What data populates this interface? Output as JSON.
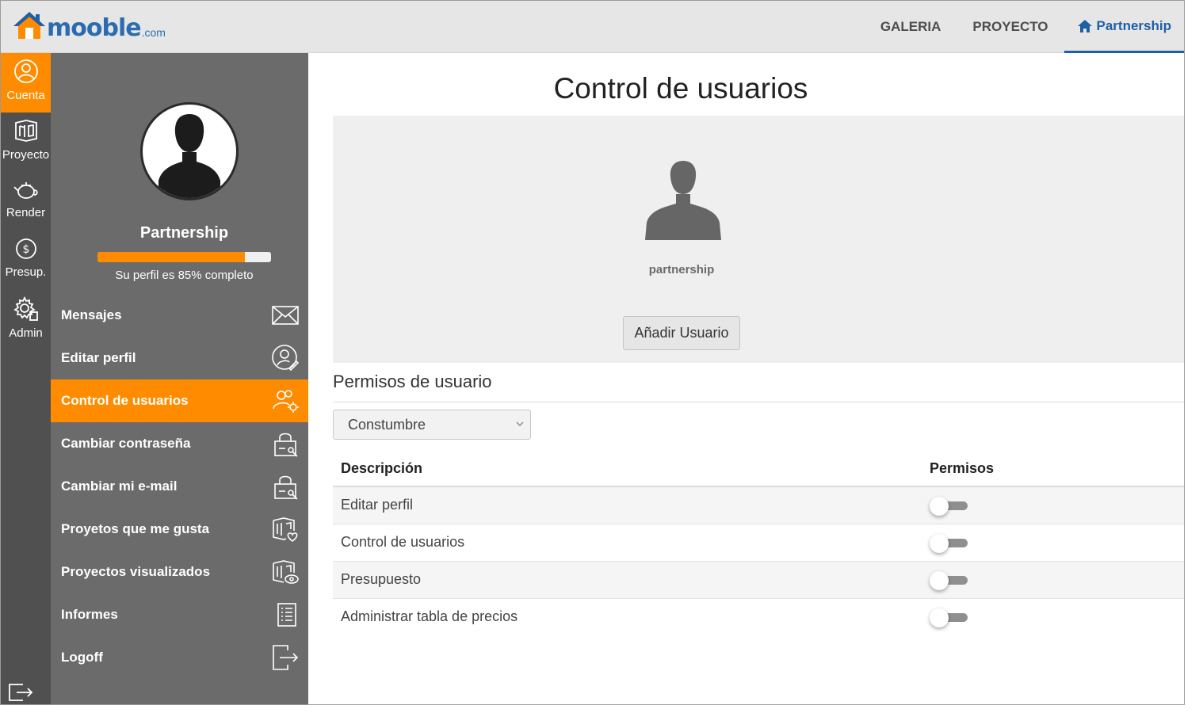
{
  "brand": {
    "name": "mooble",
    "tld": ".com",
    "logo_color": "#2b6cb0"
  },
  "topnav": {
    "items": [
      {
        "label": "GALERIA"
      },
      {
        "label": "PROYECTO"
      },
      {
        "label": "Partnership",
        "icon": "home-icon",
        "active": true
      }
    ]
  },
  "rail": {
    "items": [
      {
        "label": "Cuenta",
        "icon": "account-icon",
        "active": true
      },
      {
        "label": "Proyecto",
        "icon": "project-icon"
      },
      {
        "label": "Render",
        "icon": "teapot-icon"
      },
      {
        "label": "Presup.",
        "icon": "dollar-icon"
      },
      {
        "label": "Admin",
        "icon": "admin-gear-icon"
      }
    ],
    "exit_icon": "exit-icon"
  },
  "sidebar": {
    "profile_name": "Partnership",
    "profile_progress": 0.85,
    "progress_text": "Su perfil es 85% completo",
    "menu": [
      {
        "label": "Mensajes",
        "icon": "envelope-icon"
      },
      {
        "label": "Editar perfil",
        "icon": "edit-profile-icon"
      },
      {
        "label": "Control de usuarios",
        "icon": "user-control-icon",
        "active": true
      },
      {
        "label": "Cambiar contraseña",
        "icon": "lock-key-icon"
      },
      {
        "label": "Cambiar mi e-mail",
        "icon": "lock-key-icon"
      },
      {
        "label": "Proyetos que me gusta",
        "icon": "project-like-icon"
      },
      {
        "label": "Proyectos visualizados",
        "icon": "project-view-icon"
      },
      {
        "label": "Informes",
        "icon": "report-icon"
      },
      {
        "label": "Logoff",
        "icon": "logoff-icon"
      }
    ]
  },
  "main": {
    "title": "Control de usuarios",
    "user_label": "partnership",
    "add_user_label": "Añadir Usuario",
    "permissions_heading": "Permisos de usuario",
    "role_select": {
      "selected": "Constumbre"
    },
    "table": {
      "headers": {
        "description": "Descripción",
        "permissions": "Permisos"
      },
      "rows": [
        {
          "description": "Editar perfil",
          "enabled": false
        },
        {
          "description": "Control de usuarios",
          "enabled": false
        },
        {
          "description": "Presupuesto",
          "enabled": false
        },
        {
          "description": "Administrar tabla de precios",
          "enabled": false
        }
      ]
    }
  },
  "colors": {
    "accent": "#ff8c00",
    "sidebar": "#6b6b6b",
    "rail": "#505050",
    "link": "#1f5fa6"
  }
}
